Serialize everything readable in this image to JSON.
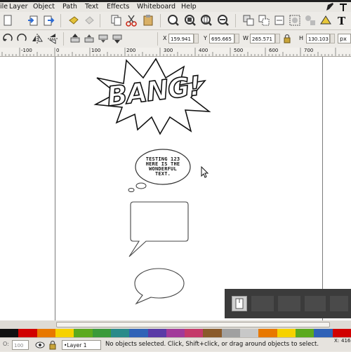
{
  "menubar": {
    "items": [
      {
        "label": "ile"
      },
      {
        "label": "Layer"
      },
      {
        "label": "Object"
      },
      {
        "label": "Path"
      },
      {
        "label": "Text"
      },
      {
        "label": "Effects"
      },
      {
        "label": "Whiteboard"
      },
      {
        "label": "Help"
      }
    ]
  },
  "controls": {
    "x_label": "X",
    "x_value": "159.941",
    "y_label": "Y",
    "y_value": "695.665",
    "w_label": "W",
    "w_value": "265.571",
    "h_label": "H",
    "h_value": "130.103",
    "unit": "px"
  },
  "ruler": {
    "labels": [
      "-100",
      "0",
      "100",
      "200",
      "300",
      "400",
      "500",
      "600",
      "700"
    ]
  },
  "canvas": {
    "bang_text": "BANG!",
    "bubble_line1": "TESTING 123",
    "bubble_line2": "HERE IS THE",
    "bubble_line3": "WONDERFUL",
    "bubble_line4": "TEXT."
  },
  "statusbar": {
    "opacity_value": "100",
    "layer_name": "•Layer 1",
    "message": "No objects selected. Click, Shift+click, or drag around objects to select.",
    "coord_x_label": "X:",
    "coord_x_value": "416"
  },
  "palette": {
    "colors": [
      "#111111",
      "#d10000",
      "#e87800",
      "#f6d200",
      "#5caa1e",
      "#3a9a3a",
      "#2a8a8a",
      "#2f62b7",
      "#5a3aa6",
      "#a23a9a",
      "#c53a6a",
      "#8a5a2a",
      "#a0a0a0",
      "#c8c8c8",
      "#e87800",
      "#f6d200",
      "#5caa1e",
      "#2f62b7",
      "#d10000"
    ]
  },
  "colors": {
    "canvas": "#ffffff",
    "toolbar": "#edebe7",
    "panel": "#3b3b3b"
  }
}
